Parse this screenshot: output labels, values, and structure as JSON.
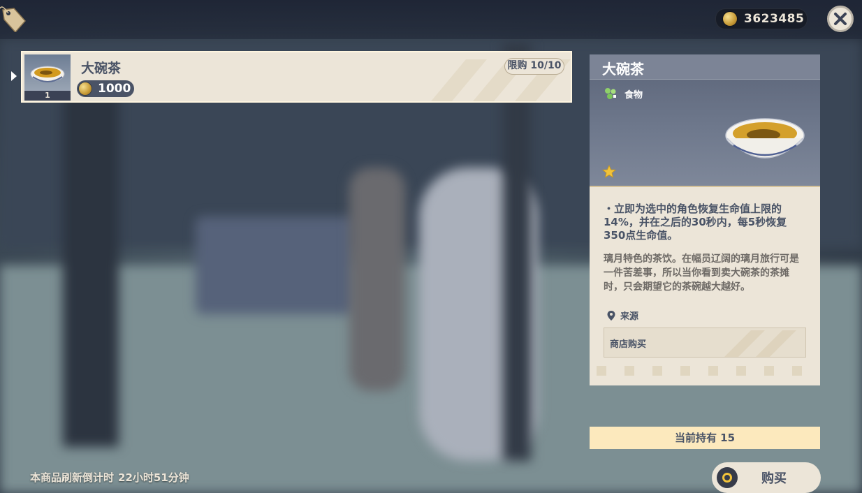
{
  "header": {
    "currency_value": "3623485"
  },
  "item_list": [
    {
      "name": "大碗茶",
      "price": "1000",
      "owned_count_thumb": "1",
      "limit": "限购 10/10"
    }
  ],
  "detail": {
    "title": "大碗茶",
    "category": "食物",
    "rarity_stars": 1,
    "description": "・立即为选中的角色恢复生命值上限的14%，并在之后的30秒内，每5秒恢复350点生命值。",
    "flavor": "璃月特色的茶饮。在幅员辽阔的璃月旅行可是一件苦差事，所以当你看到卖大碗茶的茶摊时，只会期望它的茶碗越大越好。",
    "source_label": "来源",
    "source_entry": "商店购买"
  },
  "owned_bar": "当前持有 15",
  "buy_button": "购买",
  "refresh": {
    "label": "本商品刷新倒计时",
    "time": "22小时51分钟"
  },
  "icons": {
    "tag": "price-tag-icon",
    "currency": "mora-coin-icon",
    "close": "close-icon",
    "category": "food-category-icon",
    "rarity": "star-icon",
    "source": "location-pin-icon",
    "buy": "confirm-circle-icon"
  },
  "colors": {
    "panel": "#ece5d8",
    "dark_text": "#4a5366",
    "owned_bar": "#fce9bd",
    "star": "#f2c33a"
  }
}
